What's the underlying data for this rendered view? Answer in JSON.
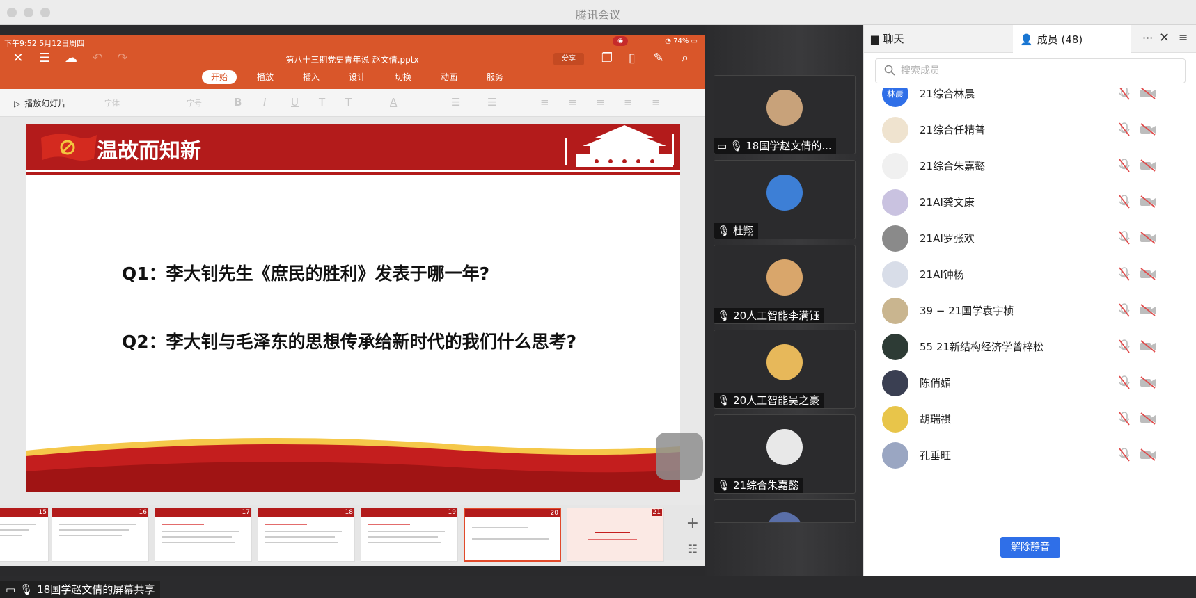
{
  "window": {
    "title": "腾讯会议"
  },
  "ipad": {
    "status_time": "下午9:52  5月12日周四",
    "battery": "74%",
    "doc_title": "第八十三期党史青年说-赵文倩.pptx",
    "share_btn": "分享",
    "tabs": [
      "开始",
      "播放",
      "插入",
      "设计",
      "切换",
      "动画",
      "服务"
    ],
    "play_label": "播放幻灯片",
    "font_placeholder": "字体",
    "size_placeholder": "字号"
  },
  "slide": {
    "title": "温故而知新",
    "q1": "Q1：李大钊先生《庶民的胜利》发表于哪一年?",
    "q2": "Q2：李大钊与毛泽东的思想传承给新时代的我们什么思考?"
  },
  "thumbnails": [
    {
      "num": "15"
    },
    {
      "num": "16"
    },
    {
      "num": "17"
    },
    {
      "num": "18"
    },
    {
      "num": "19"
    },
    {
      "num": "20"
    },
    {
      "num": "21"
    }
  ],
  "share_label": "18国学赵文倩的屏幕共享",
  "gallery": [
    {
      "name": "18国学赵文倩的...",
      "color": "#c8a27a"
    },
    {
      "name": "杜翔",
      "color": "#3d7fd6"
    },
    {
      "name": "20人工智能李满钰",
      "color": "#d9a66b"
    },
    {
      "name": "20人工智能吴之豪",
      "color": "#e7b85a"
    },
    {
      "name": "21综合朱嘉懿",
      "color": "#e8e8e8"
    }
  ],
  "panel": {
    "chat_tab": "聊天",
    "members_tab": "成员 (48)",
    "search_placeholder": "搜索成员",
    "unmute_btn": "解除静音",
    "members": [
      {
        "name": "21综合林晨",
        "avatar_text": "林晨",
        "color": "#2f6fe8"
      },
      {
        "name": "21综合任精普",
        "avatar_text": "",
        "color": "#efe3cf"
      },
      {
        "name": "21综合朱嘉懿",
        "avatar_text": "",
        "color": "#f0f0f0"
      },
      {
        "name": "21AI龚文康",
        "avatar_text": "",
        "color": "#c9c2e0"
      },
      {
        "name": "21AI罗张欢",
        "avatar_text": "",
        "color": "#8a8a8a"
      },
      {
        "name": "21AI钟杨",
        "avatar_text": "",
        "color": "#d8dde8"
      },
      {
        "name": "39 − 21国学袁宇桢",
        "avatar_text": "",
        "color": "#c9b58f"
      },
      {
        "name": "55 21新结构经济学曾梓松",
        "avatar_text": "",
        "color": "#2d3b35"
      },
      {
        "name": "陈俏媚",
        "avatar_text": "",
        "color": "#3a3f52"
      },
      {
        "name": "胡瑞祺",
        "avatar_text": "",
        "color": "#e8c54a"
      },
      {
        "name": "孔垂旺",
        "avatar_text": "",
        "color": "#9aa6c2"
      }
    ]
  }
}
